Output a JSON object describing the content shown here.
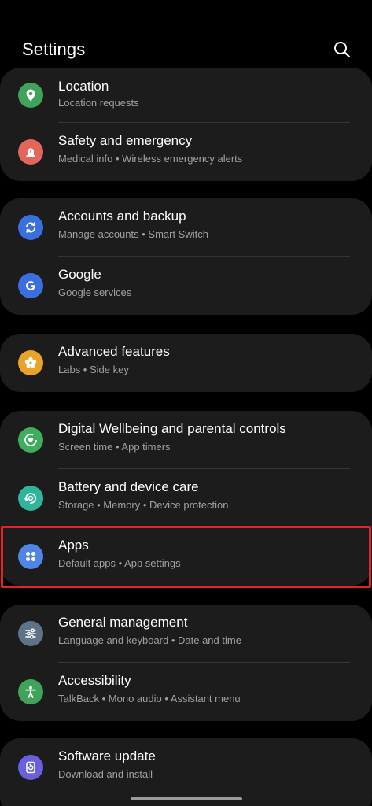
{
  "header": {
    "title": "Settings"
  },
  "groups": [
    {
      "items": [
        {
          "label": "Location",
          "sub": "Location requests"
        },
        {
          "label": "Safety and emergency",
          "sub": "Medical info  •  Wireless emergency alerts"
        }
      ]
    },
    {
      "items": [
        {
          "label": "Accounts and backup",
          "sub": "Manage accounts  •  Smart Switch"
        },
        {
          "label": "Google",
          "sub": "Google services"
        }
      ]
    },
    {
      "items": [
        {
          "label": "Advanced features",
          "sub": "Labs  •  Side key"
        }
      ]
    },
    {
      "items": [
        {
          "label": "Digital Wellbeing and parental controls",
          "sub": "Screen time  •  App timers"
        },
        {
          "label": "Battery and device care",
          "sub": "Storage  •  Memory  •  Device protection"
        },
        {
          "label": "Apps",
          "sub": "Default apps  •  App settings"
        }
      ]
    },
    {
      "items": [
        {
          "label": "General management",
          "sub": "Language and keyboard  •  Date and time"
        },
        {
          "label": "Accessibility",
          "sub": "TalkBack  •  Mono audio  •  Assistant menu"
        }
      ]
    },
    {
      "items": [
        {
          "label": "Software update",
          "sub": "Download and install"
        }
      ]
    }
  ],
  "colors": {
    "location": "#3fa35a",
    "safety": "#e2665a",
    "accounts": "#3b6fe0",
    "google": "#3b6fe0",
    "advanced": "#e8a42a",
    "wellbeing": "#3fae5c",
    "battery": "#2fb59a",
    "apps": "#4f86e6",
    "general": "#5f7387",
    "accessibility": "#3fa35a",
    "software": "#6a5fe0",
    "highlight": "#e2232a"
  },
  "icons": {
    "location": "location-pin-icon",
    "safety": "siren-icon",
    "accounts": "sync-icon",
    "google": "google-g-icon",
    "advanced": "gear-flower-icon",
    "wellbeing": "heart-ring-icon",
    "battery": "device-care-icon",
    "apps": "apps-grid-icon",
    "general": "sliders-icon",
    "accessibility": "accessibility-person-icon",
    "software": "update-icon"
  }
}
